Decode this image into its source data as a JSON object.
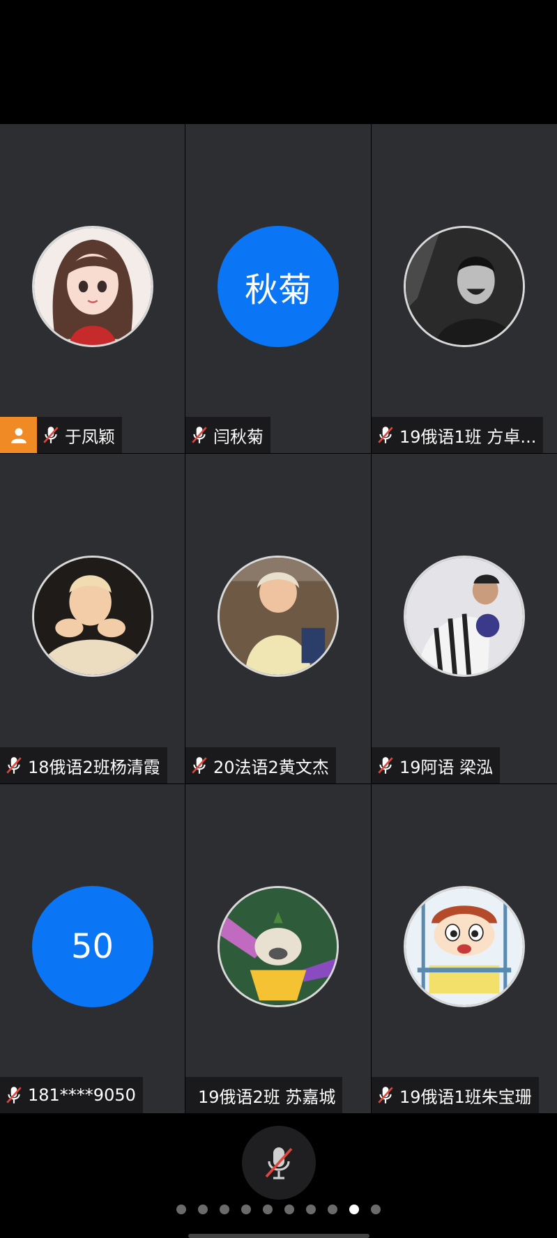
{
  "participants": [
    {
      "name": "于凤颖",
      "avatar": "girl-portrait",
      "muted": true,
      "host": true
    },
    {
      "name": "闫秋菊",
      "avatar_text": "秋菊",
      "avatar_color": "#0a75f5",
      "muted": true,
      "host": false
    },
    {
      "name": "19俄语1班 方卓...",
      "avatar": "laughing-man-bw",
      "muted": true,
      "host": false
    },
    {
      "name": "18俄语2班杨清霞",
      "avatar": "child-photo",
      "muted": true,
      "host": false
    },
    {
      "name": "20法语2黄文杰",
      "avatar": "baby-photo",
      "muted": true,
      "host": false
    },
    {
      "name": "19阿语 梁泓",
      "avatar": "footballer-photo",
      "muted": true,
      "host": false
    },
    {
      "name": "181****9050",
      "avatar_text": "50",
      "avatar_color": "#0a75f5",
      "muted": true,
      "host": false
    },
    {
      "name": "19俄语2班 苏嘉城",
      "avatar": "dog-cartoon",
      "muted": false,
      "host": false
    },
    {
      "name": "19俄语1班朱宝珊",
      "avatar": "crayon-cartoon",
      "muted": true,
      "host": false
    }
  ],
  "controls": {
    "mic": "mic-muted-icon"
  },
  "pagination": {
    "pages": 10,
    "active_index": 8
  },
  "colors": {
    "tile": "#2d2e32",
    "accent": "#0a75f5",
    "host": "#f08a24",
    "muted": "#e0463c"
  }
}
